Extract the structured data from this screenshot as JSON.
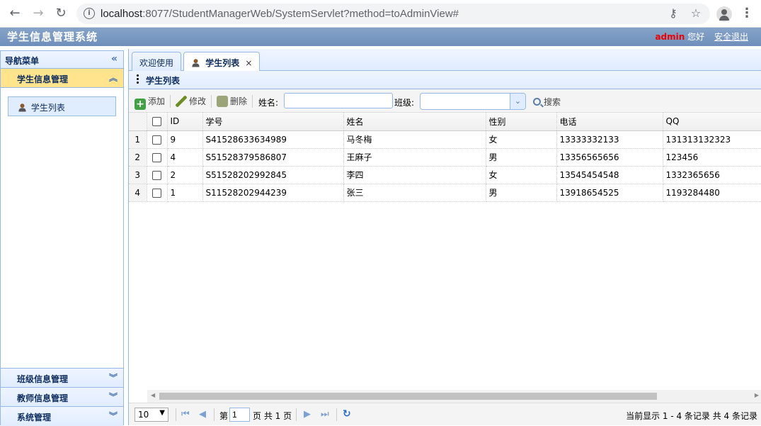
{
  "browser": {
    "url_host": "localhost",
    "url_rest": ":8077/StudentManagerWeb/SystemServlet?method=toAdminView#"
  },
  "header": {
    "title": "学生信息管理系统",
    "user": "admin",
    "greeting": "您好",
    "logout": "安全退出"
  },
  "sidebar": {
    "title": "导航菜单",
    "sections": [
      {
        "label": "学生信息管理",
        "active": true,
        "items": [
          {
            "label": "学生列表"
          }
        ]
      },
      {
        "label": "班级信息管理"
      },
      {
        "label": "教师信息管理"
      },
      {
        "label": "系统管理"
      }
    ]
  },
  "tabs": [
    {
      "label": "欢迎使用",
      "selected": false
    },
    {
      "label": "学生列表",
      "selected": true,
      "close": "×"
    }
  ],
  "list": {
    "title": "学生列表"
  },
  "toolbar": {
    "add": "添加",
    "edit": "修改",
    "delete": "删除",
    "name_label": "姓名:",
    "name_value": "",
    "class_label": "班级:",
    "class_value": "",
    "search": "搜索"
  },
  "table": {
    "columns": [
      "ID",
      "学号",
      "姓名",
      "性别",
      "电话",
      "QQ"
    ],
    "rows": [
      {
        "num": "1",
        "id": "9",
        "sn": "S41528633634989",
        "name": "马冬梅",
        "sex": "女",
        "phone": "13333332133",
        "qq": "131313132323"
      },
      {
        "num": "2",
        "id": "4",
        "sn": "S51528379586807",
        "name": "王麻子",
        "sex": "男",
        "phone": "13356565656",
        "qq": "123456"
      },
      {
        "num": "3",
        "id": "2",
        "sn": "S51528202992845",
        "name": "李四",
        "sex": "女",
        "phone": "13545454548",
        "qq": "1332365656"
      },
      {
        "num": "4",
        "id": "1",
        "sn": "S11528202944239",
        "name": "张三",
        "sex": "男",
        "phone": "13918654525",
        "qq": "1193284480"
      }
    ]
  },
  "pager": {
    "page_size": "10",
    "page_prefix": "第",
    "page_value": "1",
    "page_suffix": "页 共 1 页",
    "info": "当前显示 1 - 4 条记录 共 4 条记录"
  }
}
